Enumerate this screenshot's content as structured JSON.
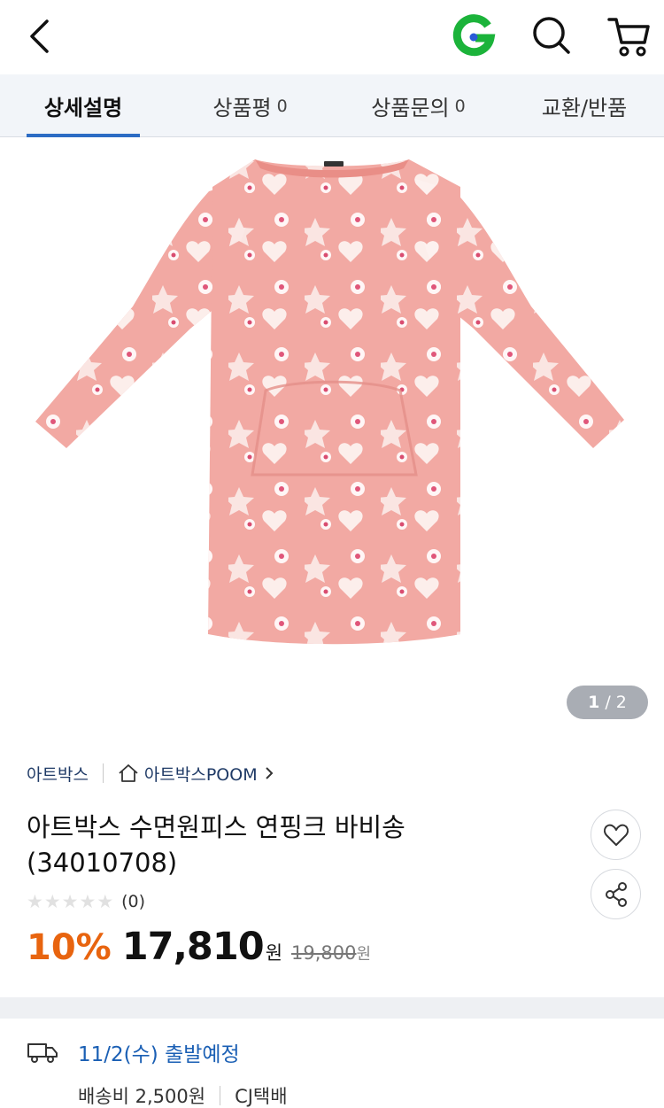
{
  "header": {
    "icons": [
      "back-icon",
      "gmarket-g-logo",
      "search-icon",
      "cart-icon"
    ]
  },
  "tabs": [
    {
      "label": "상세설명",
      "count": ""
    },
    {
      "label": "상품평",
      "count": "0"
    },
    {
      "label": "상품문의",
      "count": "0"
    },
    {
      "label": "교환/반품",
      "count": ""
    }
  ],
  "gallery": {
    "current": "1",
    "separator": "/",
    "total": "2"
  },
  "brand": {
    "name": "아트박스",
    "store": "아트박스POOM",
    "store_icon": "home-icon"
  },
  "product": {
    "title": "아트박스 수면원피스 연핑크 바비송 (34010708)",
    "rating_stars": 0,
    "review_count": "(0)",
    "discount": "10%",
    "price": "17,810",
    "currency": "원",
    "original_price": "19,800",
    "original_currency": "원"
  },
  "shipping": {
    "icon": "truck-icon",
    "date": "11/2(수) 출발예정",
    "fee": "배송비 2,500원",
    "carrier": "CJ택배"
  },
  "colors": {
    "accent_blue": "#2c6cc4",
    "discount_orange": "#e8640f",
    "product_pink": "#f2a9a3"
  }
}
